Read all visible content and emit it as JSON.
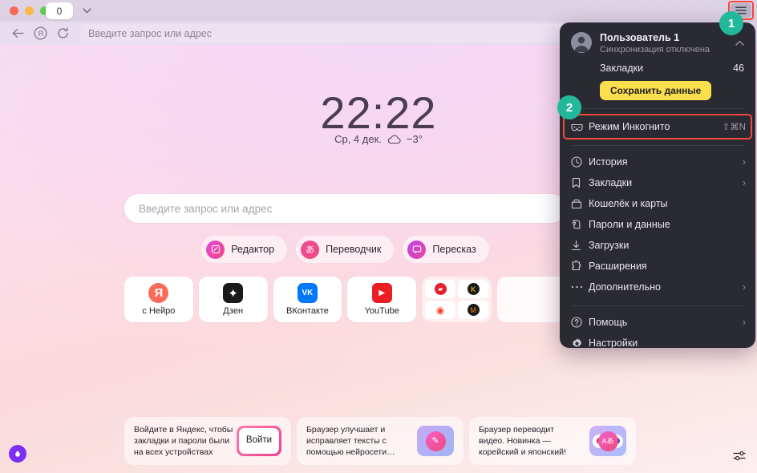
{
  "window": {
    "tab_count_label": "0",
    "traffic_lights": [
      "close",
      "minimize",
      "zoom"
    ]
  },
  "toolbar": {
    "back_icon": "arrow-left-icon",
    "yandex_icon": "yandex-logo-icon",
    "reload_icon": "reload-icon",
    "omnibox_placeholder": "Введите запрос или адрес",
    "menu_icon": "hamburger-menu-icon"
  },
  "newtab": {
    "clock_time": "22:22",
    "date_text": "Ср, 4 дек.",
    "weather_temp": "−3°",
    "weather_icon": "cloud-icon",
    "search_placeholder": "Введите запрос или адрес",
    "quick_actions": [
      {
        "label": "Редактор",
        "icon": "editor-icon",
        "glyph": "✎"
      },
      {
        "label": "Переводчик",
        "icon": "translate-icon",
        "glyph": "あ"
      },
      {
        "label": "Пересказ",
        "icon": "retell-icon",
        "glyph": "⌨"
      }
    ],
    "tiles": [
      {
        "label": "с Нейро",
        "icon": "yandex-neuro-icon",
        "glyph": "Я"
      },
      {
        "label": "Дзен",
        "icon": "dzen-icon",
        "glyph": "✦"
      },
      {
        "label": "ВКонтакте",
        "icon": "vk-icon",
        "glyph": "VK"
      },
      {
        "label": "YouTube",
        "icon": "youtube-icon",
        "glyph": "▶"
      }
    ],
    "tile_group_icons": [
      "auto-ru-icon",
      "kinopoisk-icon",
      "maps-icon",
      "market-icon"
    ],
    "promos": [
      {
        "text": "Войдите в Яндекс, чтобы закладки и пароли были на всех устройствах",
        "button_label": "Войти"
      },
      {
        "text": "Браузер улучшает и исправляет тексты с помощью нейросети…",
        "image_icon": "editor-promo-icon"
      },
      {
        "text": "Браузер переводит видео. Новинка — корейский и японский!",
        "image_icon": "translate-promo-icon"
      }
    ],
    "alice_icon": "alice-logo-icon",
    "settings_icon": "ntp-settings-sliders-icon"
  },
  "menu": {
    "profile": {
      "name": "Пользователь 1",
      "status": "Синхронизация отключена",
      "avatar_icon": "user-avatar-icon",
      "collapse_icon": "chevron-up-icon"
    },
    "bookmarks": {
      "label": "Закладки",
      "count": "46"
    },
    "save_button_label": "Сохранить данные",
    "incognito": {
      "label": "Режим Инкогнито",
      "shortcut": "⇧⌘N",
      "icon": "incognito-mask-icon"
    },
    "items": [
      {
        "label": "История",
        "icon": "clock-icon",
        "arrow": "›"
      },
      {
        "label": "Закладки",
        "icon": "bookmark-icon",
        "arrow": "›"
      },
      {
        "label": "Кошелёк и карты",
        "icon": "wallet-icon",
        "arrow": ""
      },
      {
        "label": "Пароли и данные",
        "icon": "key-icon",
        "arrow": ""
      },
      {
        "label": "Загрузки",
        "icon": "download-icon",
        "arrow": ""
      },
      {
        "label": "Расширения",
        "icon": "puzzle-icon",
        "arrow": ""
      },
      {
        "label": "Дополнительно",
        "icon": "ellipsis-icon",
        "arrow": "›"
      }
    ],
    "footer_items": [
      {
        "label": "Помощь",
        "icon": "help-circle-icon",
        "arrow": "›"
      },
      {
        "label": "Настройки",
        "icon": "gear-icon",
        "arrow": ""
      }
    ]
  },
  "annotations": {
    "badge_1": "1",
    "badge_2": "2",
    "badge_color": "#23b89b",
    "highlight_color": "#f4483c"
  }
}
